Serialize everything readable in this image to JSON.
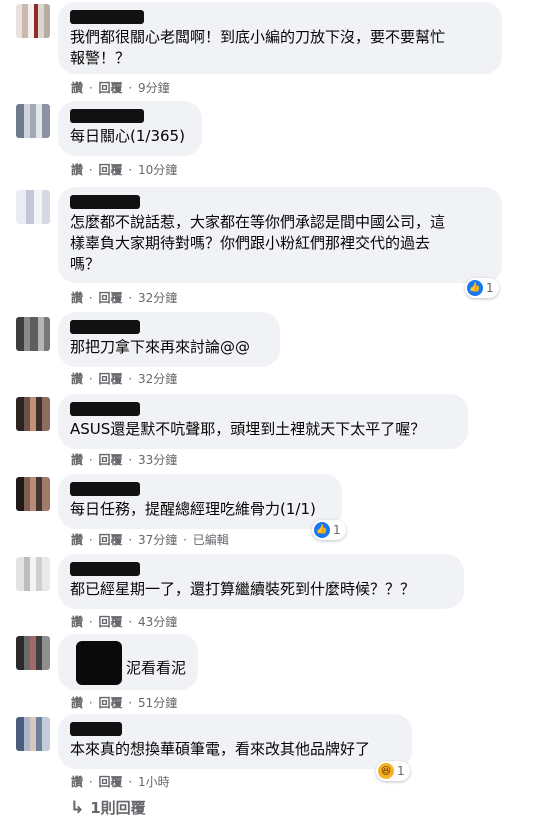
{
  "actions": {
    "like": "讚",
    "reply": "回覆",
    "sep": "·"
  },
  "colors": {
    "bubble": "#f0f2f5",
    "meta": "#65676b",
    "like": "#1877f2",
    "haha": "#f7b125"
  },
  "comments": [
    {
      "text": "我們都很關心老闆啊！到底小編的刀放下沒，要不要幫忙\n報警！？",
      "time": "9分鐘"
    },
    {
      "text": "每日關心(1/365)",
      "time": "10分鐘"
    },
    {
      "text": "怎麼都不說話惹，大家都在等你們承認是間中國公司，這\n樣辜負大家期待對嗎？你們跟小粉紅們那裡交代的過去\n嗎？",
      "time": "32分鐘",
      "reaction": {
        "icon": "like-icon",
        "count": "1"
      }
    },
    {
      "text": "那把刀拿下來再來討論@@",
      "time": "32分鐘"
    },
    {
      "text": "ASUS還是默不吭聲耶，頭埋到土裡就天下太平了喔？",
      "time": "33分鐘"
    },
    {
      "text": "每日任務，提醒總經理吃維骨力(1/1)",
      "time": "37分鐘",
      "edited": "已編輯",
      "reaction": {
        "icon": "like-icon",
        "count": "1"
      }
    },
    {
      "text": "都已經星期一了，還打算繼續裝死到什麼時候？？？",
      "time": "43分鐘"
    },
    {
      "text": "泥看看泥",
      "time": "51分鐘"
    },
    {
      "text": "本來真的想換華碩筆電，看來改其他品牌好了",
      "time": "1小時",
      "reaction": {
        "icon": "haha-icon",
        "count": "1"
      }
    }
  ],
  "replies": {
    "icon": "reply-arrow-icon",
    "label": "1則回覆"
  }
}
